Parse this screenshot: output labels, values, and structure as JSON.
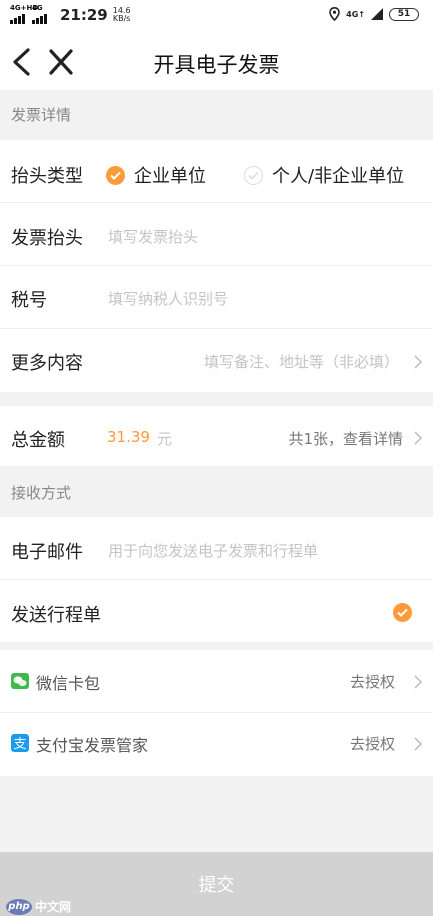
{
  "status_bar": {
    "sim1": "4G+HD",
    "sim2": "4G",
    "time": "21:29",
    "speed_value": "14.6",
    "speed_unit": "KB/s",
    "network": "4G↑",
    "battery": "51"
  },
  "header": {
    "title": "开具电子发票",
    "back_icon": "chevron-left-icon",
    "close_icon": "close-icon"
  },
  "invoice_details": {
    "section_title": "发票详情",
    "header_type": {
      "label": "抬头类型",
      "options": [
        "企业单位",
        "个人/非企业单位"
      ],
      "selected": "企业单位"
    },
    "invoice_title": {
      "label": "发票抬头",
      "placeholder": "填写发票抬头"
    },
    "tax_number": {
      "label": "税号",
      "placeholder": "填写纳税人识别号"
    },
    "more_content": {
      "label": "更多内容",
      "placeholder": "填写备注、地址等（非必填）"
    }
  },
  "total": {
    "label": "总金额",
    "amount": "31.39",
    "unit": "元",
    "detail_link": "共1张，查看详情"
  },
  "delivery": {
    "section_title": "接收方式",
    "email": {
      "label": "电子邮件",
      "placeholder": "用于向您发送电子发票和行程单"
    },
    "send_itinerary": {
      "label": "发送行程单",
      "checked": true
    }
  },
  "authorizations": [
    {
      "name": "微信卡包",
      "action": "去授权",
      "icon": "wechat-card-icon"
    },
    {
      "name": "支付宝发票管家",
      "action": "去授权",
      "icon": "alipay-icon"
    }
  ],
  "submit_label": "提交",
  "watermark": {
    "php": "php",
    "cn": "中文网"
  },
  "colors": {
    "accent": "#ff9a38",
    "background": "#f2f2f2",
    "submit_disabled": "#d2d2d2",
    "wechat": "#3fb94e",
    "alipay": "#1a9bf0"
  }
}
